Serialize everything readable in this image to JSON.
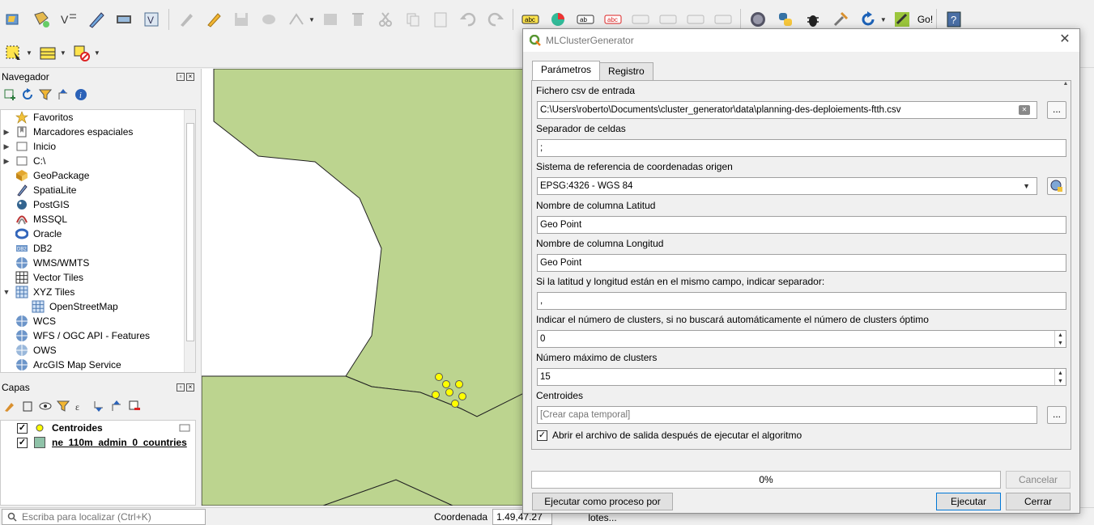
{
  "toolbar": {
    "go_label": "Go!"
  },
  "navigator": {
    "title": "Navegador",
    "items": [
      {
        "label": "Favoritos",
        "expandable": false,
        "icon": "star-icon"
      },
      {
        "label": "Marcadores espaciales",
        "expandable": true,
        "icon": "bookmarks-icon"
      },
      {
        "label": "Inicio",
        "expandable": true,
        "icon": "folder-icon"
      },
      {
        "label": "C:\\",
        "expandable": true,
        "icon": "folder-icon"
      },
      {
        "label": "GeoPackage",
        "expandable": false,
        "icon": "geopackage-icon"
      },
      {
        "label": "SpatiaLite",
        "expandable": false,
        "icon": "spatialite-icon"
      },
      {
        "label": "PostGIS",
        "expandable": false,
        "icon": "postgis-icon"
      },
      {
        "label": "MSSQL",
        "expandable": false,
        "icon": "mssql-icon"
      },
      {
        "label": "Oracle",
        "expandable": false,
        "icon": "oracle-icon"
      },
      {
        "label": "DB2",
        "expandable": false,
        "icon": "db2-icon"
      },
      {
        "label": "WMS/WMTS",
        "expandable": false,
        "icon": "wms-icon"
      },
      {
        "label": "Vector Tiles",
        "expandable": false,
        "icon": "vector-tiles-icon"
      },
      {
        "label": "XYZ Tiles",
        "expandable": true,
        "icon": "xyz-tiles-icon"
      },
      {
        "label": "OpenStreetMap",
        "expandable": false,
        "icon": "xyz-tiles-icon"
      },
      {
        "label": "WCS",
        "expandable": false,
        "icon": "wcs-icon"
      },
      {
        "label": "WFS / OGC API - Features",
        "expandable": false,
        "icon": "wfs-icon"
      },
      {
        "label": "OWS",
        "expandable": false,
        "icon": "ows-icon"
      },
      {
        "label": "ArcGIS Map Service",
        "expandable": false,
        "icon": "arcgis-icon"
      }
    ]
  },
  "layers": {
    "title": "Capas",
    "items": [
      {
        "label": "Centroides",
        "checked": true,
        "color": "#ffff00"
      },
      {
        "label": "ne_110m_admin_0_countries",
        "checked": true,
        "color": "#8fc2a8"
      }
    ]
  },
  "status": {
    "locator_placeholder": "Escriba para localizar (Ctrl+K)",
    "coord_label": "Coordenada",
    "coord_value": "1.49,47.27"
  },
  "dialog": {
    "title": "MLClusterGenerator",
    "tabs": [
      "Parámetros",
      "Registro"
    ],
    "fields": {
      "csv_label": "Fichero csv de entrada",
      "csv_value": "C:\\Users\\roberto\\Documents\\cluster_generator\\data\\planning-des-deploiements-ftth.csv",
      "sep_label": "Separador de celdas",
      "sep_value": ";",
      "crs_label": "Sistema de referencia de coordenadas origen",
      "crs_value": "EPSG:4326 - WGS 84",
      "lat_label": "Nombre de columna Latitud",
      "lat_value": "Geo Point",
      "lon_label": "Nombre de columna Longitud",
      "lon_value": "Geo Point",
      "samefield_label": "Si la latitud y longitud están en el mismo campo, indicar separador:",
      "samefield_value": ",",
      "nclusters_label": "Indicar el número de clusters, si no buscará automáticamente el número de clusters óptimo",
      "nclusters_value": "0",
      "maxclusters_label": "Número máximo de clusters",
      "maxclusters_value": "15",
      "centroids_label": "Centroides",
      "centroids_placeholder": "[Crear capa temporal]",
      "open_output_label": "Abrir el archivo de salida después de ejecutar el algoritmo",
      "ellipsis": "..."
    },
    "progress": "0%",
    "buttons": {
      "cancel": "Cancelar",
      "batch": "Ejecutar como proceso por lotes...",
      "run": "Ejecutar",
      "close": "Cerrar"
    }
  }
}
